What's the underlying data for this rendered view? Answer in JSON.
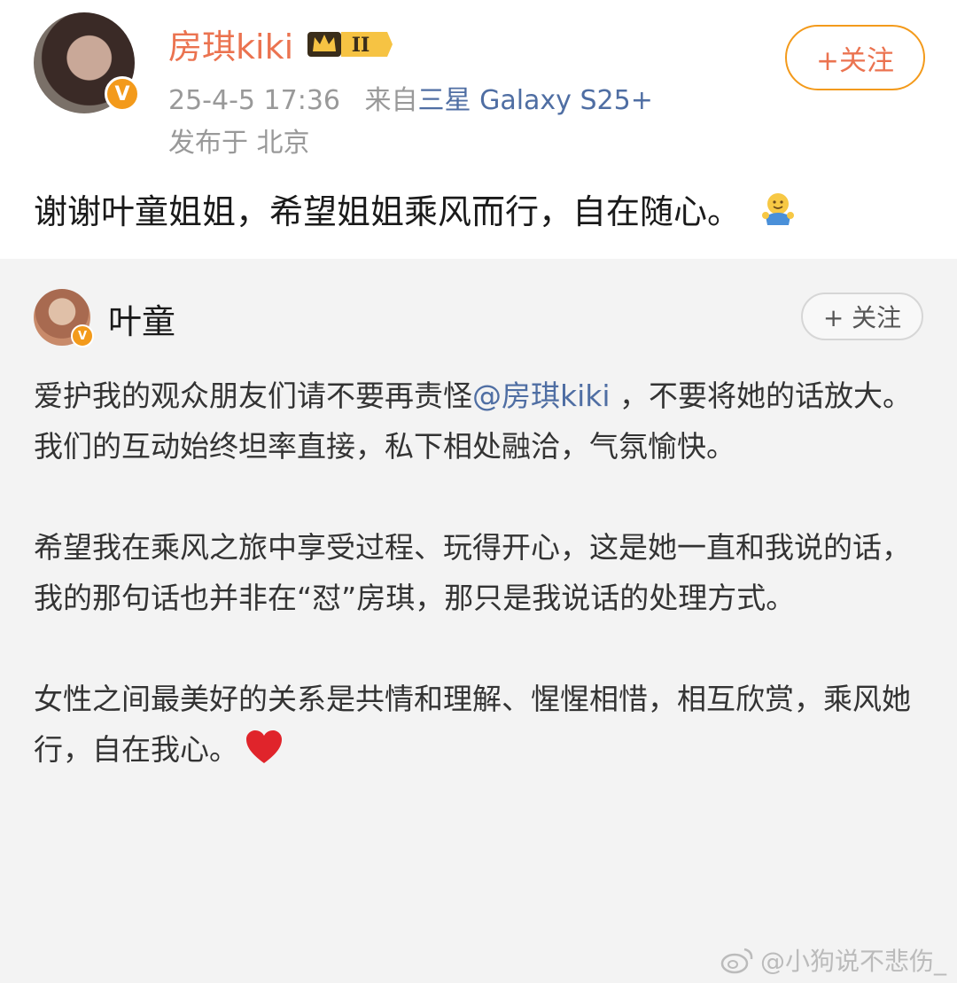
{
  "post": {
    "username": "房琪kiki",
    "level_badge": "II",
    "follow_label": "+关注",
    "time": "25-4-5 17:36",
    "from_prefix": "来自",
    "device": "三星 Galaxy S25+",
    "location": "发布于 北京",
    "text": "谢谢叶童姐姐，希望姐姐乘风而行，自在随心。",
    "emoji": "hug-emoji",
    "verified_badge": "V"
  },
  "repost": {
    "username": "叶童",
    "follow_label": "+ 关注",
    "verified_badge": "V",
    "p1_before": "爱护我的观众朋友们请不要再责怪",
    "p1_mention": "@房琪kiki",
    "p1_after": " ，不要将她的话放大。我们的互动始终坦率直接，私下相处融洽，气氛愉快。",
    "p2": "希望我在乘风之旅中享受过程、玩得开心，这是她一直和我说的话，我的那句话也并非在“怼”房琪，那只是我说话的处理方式。",
    "p3": "女性之间最美好的关系是共情和理解、惺惺相惜，相互欣赏，乘风她行，自在我心。",
    "emoji": "red-heart-emoji"
  },
  "watermark": "@小狗说不悲伤_",
  "colors": {
    "name_orange": "#eb7350",
    "badge_orange": "#f39a1b",
    "link_blue": "#4f6ea3",
    "repost_bg": "#f3f3f3"
  }
}
